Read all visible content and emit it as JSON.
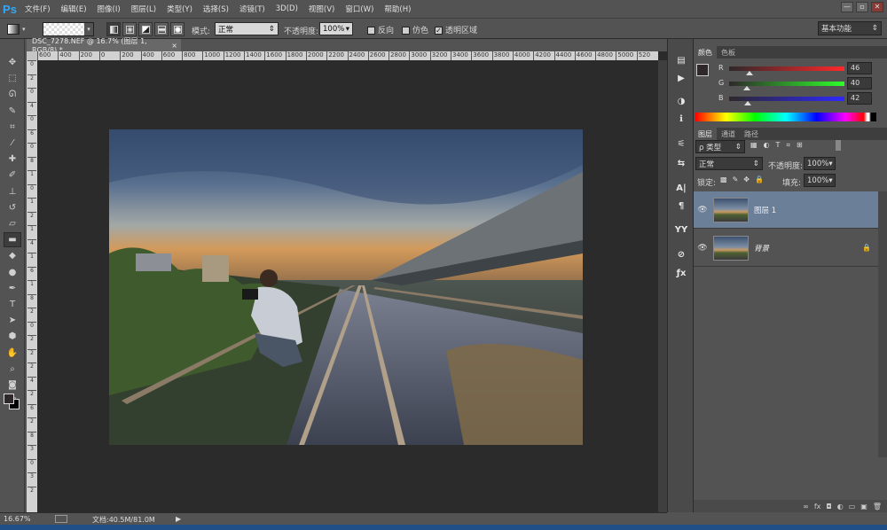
{
  "app": {
    "logo": "Ps"
  },
  "menu": [
    "文件(F)",
    "编辑(E)",
    "图像(I)",
    "图层(L)",
    "类型(Y)",
    "选择(S)",
    "滤镜(T)",
    "3D(D)",
    "视图(V)",
    "窗口(W)",
    "帮助(H)"
  ],
  "window_controls": {
    "minimize": "—",
    "maximize": "▫",
    "close": "✕"
  },
  "options": {
    "mode_label": "模式:",
    "mode_value": "正常",
    "opacity_label": "不透明度:",
    "opacity_value": "100%",
    "reverse_label": "反向",
    "dither_label": "仿色",
    "transparency_label": "透明区域",
    "reverse_checked": false,
    "dither_checked": false,
    "transparency_checked": true
  },
  "workspace": {
    "value": "基本功能"
  },
  "document": {
    "tab_title": "DSC_7278.NEF @ 16.7% (图层 1, RGB/8) *",
    "close_glyph": "×",
    "ruler_top": [
      "600",
      "400",
      "200",
      "0",
      "200",
      "400",
      "600",
      "800",
      "1000",
      "1200",
      "1400",
      "1600",
      "1800",
      "2000",
      "2200",
      "2400",
      "2600",
      "2800",
      "3000",
      "3200",
      "3400",
      "3600",
      "3800",
      "4000",
      "4200",
      "4400",
      "4600",
      "4800",
      "5000",
      "520"
    ],
    "ruler_left": [
      "0",
      "2",
      "0",
      "4",
      "0",
      "6",
      "0",
      "8",
      "1",
      "0",
      "1",
      "2",
      "1",
      "4",
      "1",
      "6",
      "1",
      "8",
      "2",
      "0",
      "2",
      "2",
      "2",
      "4",
      "2",
      "6",
      "2",
      "8",
      "3",
      "0",
      "3",
      "2"
    ]
  },
  "status": {
    "zoom": "16.67%",
    "doc_info": "文档:40.5M/81.0M",
    "arrow": "▶"
  },
  "tools": [
    {
      "name": "move-tool-icon",
      "glyph": "✥"
    },
    {
      "name": "marquee-tool-icon",
      "glyph": "⬚"
    },
    {
      "name": "lasso-tool-icon",
      "glyph": "ᘏ"
    },
    {
      "name": "quick-select-tool-icon",
      "glyph": "✎"
    },
    {
      "name": "crop-tool-icon",
      "glyph": "⌗"
    },
    {
      "name": "eyedropper-tool-icon",
      "glyph": "⁄"
    },
    {
      "name": "healing-brush-tool-icon",
      "glyph": "✚"
    },
    {
      "name": "brush-tool-icon",
      "glyph": "✐"
    },
    {
      "name": "clone-stamp-tool-icon",
      "glyph": "⊥"
    },
    {
      "name": "history-brush-tool-icon",
      "glyph": "↺"
    },
    {
      "name": "eraser-tool-icon",
      "glyph": "▱"
    },
    {
      "name": "gradient-tool-icon",
      "glyph": "▬"
    },
    {
      "name": "blur-tool-icon",
      "glyph": "◆"
    },
    {
      "name": "dodge-tool-icon",
      "glyph": "●"
    },
    {
      "name": "pen-tool-icon",
      "glyph": "✒"
    },
    {
      "name": "type-tool-icon",
      "glyph": "T"
    },
    {
      "name": "path-select-tool-icon",
      "glyph": "➤"
    },
    {
      "name": "shape-tool-icon",
      "glyph": "⬢"
    },
    {
      "name": "hand-tool-icon",
      "glyph": "✋"
    },
    {
      "name": "zoom-tool-icon",
      "glyph": "⌕"
    },
    {
      "name": "quick-mask-icon",
      "glyph": "◙"
    },
    {
      "name": "screen-mode-icon",
      "glyph": "▣"
    }
  ],
  "color_panel": {
    "tabs": [
      "颜色",
      "色板"
    ],
    "r_label": "R",
    "g_label": "G",
    "b_label": "B",
    "r_value": "46",
    "g_value": "40",
    "b_value": "42",
    "r_level": 0.18,
    "g_level": 0.157,
    "b_level": 0.165
  },
  "layers_panel": {
    "tabs": [
      "图层",
      "通道",
      "路径"
    ],
    "filter_label": "ρ 类型",
    "blend_mode": "正常",
    "opacity_label": "不透明度:",
    "opacity_value": "100%",
    "lock_label": "锁定:",
    "fill_label": "填充:",
    "fill_value": "100%",
    "layers": [
      {
        "name": "图层 1",
        "eye": "👁",
        "lock": ""
      },
      {
        "name": "背景",
        "eye": "👁",
        "lock": "🔒"
      }
    ],
    "footer_icons": [
      "∞",
      "fx",
      "◘",
      "◐",
      "▭",
      "▣",
      "🗑"
    ]
  },
  "colors": {
    "accent": "#30a9fb",
    "selected_layer": "#6b7f99",
    "panel_bg": "#535353",
    "canvas_bg": "#2b2b2b"
  }
}
